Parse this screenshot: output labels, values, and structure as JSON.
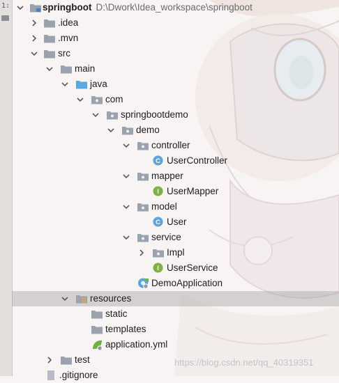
{
  "gutter": {
    "glyph": "1:"
  },
  "project": {
    "name": "springboot",
    "path": "D:\\Dwork\\Idea_workspace\\springboot"
  },
  "tree": {
    "idea": ".idea",
    "mvn": ".mvn",
    "src": "src",
    "main": "main",
    "java": "java",
    "com": "com",
    "springbootdemo": "springbootdemo",
    "demo": "demo",
    "controller": "controller",
    "usercontroller": "UserController",
    "mapper": "mapper",
    "usermapper": "UserMapper",
    "model": "model",
    "user": "User",
    "service": "service",
    "impl": "Impl",
    "userservice": "UserService",
    "demoapplication": "DemoApplication",
    "resources": "resources",
    "static": "static",
    "templates": "templates",
    "applicationyml": "application.yml",
    "test": "test",
    "gitignore": ".gitignore"
  },
  "icon_badges": {
    "class": "C",
    "interface": "I"
  },
  "colors": {
    "folder": "#9aa3ad",
    "source_folder": "#5aa9e6",
    "class_icon": "#5ba4dc",
    "interface_icon": "#7cb342",
    "spring": "#6db33f",
    "selection": "#b5b3b2"
  },
  "watermark": "https://blog.csdn.net/qq_40319351"
}
